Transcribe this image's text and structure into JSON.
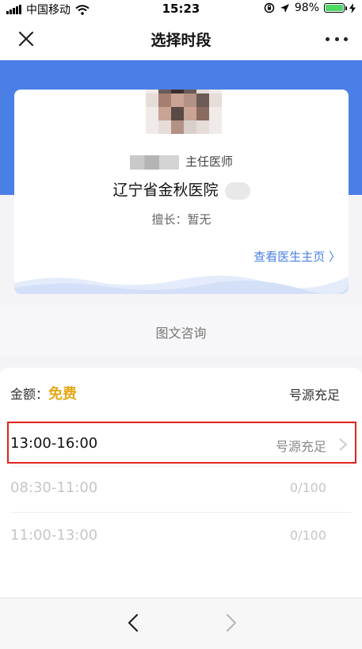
{
  "status_bar": {
    "carrier": "中国移动",
    "time": "15:23",
    "battery_percent": "98%",
    "battery_level": 0.98,
    "icons": [
      "signal-icon",
      "wifi-icon",
      "rotation-lock-icon",
      "location-icon",
      "battery-icon",
      "charging-icon"
    ]
  },
  "nav": {
    "title": "选择时段",
    "close_icon": "close-icon",
    "more_icon": "more-icon"
  },
  "doctor": {
    "title": "主任医师",
    "hospital": "辽宁省金秋医院",
    "specialty": "擅长：暂无",
    "home_link": "查看医生主页 〉"
  },
  "service": {
    "type": "图文咨询"
  },
  "fee": {
    "label": "金额：",
    "value": "免费",
    "status": "号源充足"
  },
  "slots": [
    {
      "time": "13:00-16:00",
      "status": "号源充足",
      "enabled": true
    },
    {
      "time": "08:30-11:00",
      "status": "0/100",
      "enabled": false
    },
    {
      "time": "11:00-13:00",
      "status": "0/100",
      "enabled": false
    }
  ],
  "colors": {
    "accent_blue": "#4a7fe6",
    "fee_gold": "#e6a817",
    "highlight_red": "#e0231c"
  }
}
